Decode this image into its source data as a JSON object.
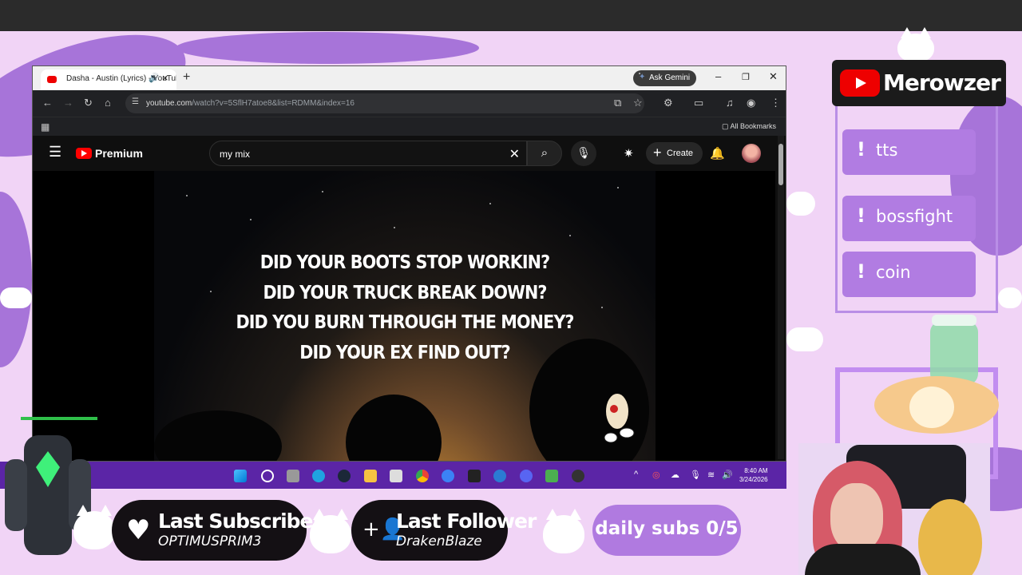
{
  "browser": {
    "tab_title": "Dasha - Austin (Lyrics) - YouTube",
    "ask_gemini": "Ask Gemini",
    "url_host": "youtube.com",
    "url_path": "/watch?v=5SflH7atoe8&list=RDMM&index=16",
    "all_bookmarks": "All Bookmarks"
  },
  "youtube": {
    "brand": "Premium",
    "search_value": "my mix",
    "create_label": "Create"
  },
  "video": {
    "lyrics": [
      "DID YOUR BOOTS STOP WORKIN?",
      "DID YOUR TRUCK BREAK DOWN?",
      "DID YOU BURN THROUGH THE MONEY?",
      "DID YOUR EX FIND OUT?"
    ]
  },
  "taskbar": {
    "time": "8:40 AM",
    "date": "3/24/2026"
  },
  "overlay": {
    "channel_name": "Merowzer",
    "commands": [
      "tts",
      "bossfight",
      "coin"
    ],
    "last_subscriber_title": "Last Subscriber",
    "last_subscriber_name": "OPTIMUSPRIM3",
    "last_follower_title": "Last Follower",
    "last_follower_name": "DrakenBlaze",
    "daily_subs": "daily subs 0/5"
  },
  "colors": {
    "stream_bg": "#f1d4f6",
    "accent_purple": "#b07ae0",
    "taskbar": "#5b25a6",
    "youtube_red": "#ff0000"
  }
}
